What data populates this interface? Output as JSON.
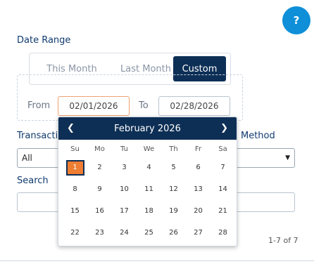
{
  "help": {
    "label": "?"
  },
  "date_range": {
    "label": "Date Range",
    "options": [
      "This Month",
      "Last Month",
      "Custom"
    ],
    "selected": "Custom"
  },
  "range": {
    "from_label": "From",
    "from_value": "02/01/2026",
    "to_label": "To",
    "to_value": "02/28/2026"
  },
  "filters": {
    "transaction_label": "Transactio",
    "transaction_value": "All",
    "method_label": "Method",
    "search_label": "Search"
  },
  "calendar": {
    "title": "February 2026",
    "weekdays": [
      "Su",
      "Mo",
      "Tu",
      "We",
      "Th",
      "Fr",
      "Sa"
    ],
    "weeks": [
      [
        "1",
        "2",
        "3",
        "4",
        "5",
        "6",
        "7"
      ],
      [
        "8",
        "9",
        "10",
        "11",
        "12",
        "13",
        "14"
      ],
      [
        "15",
        "16",
        "17",
        "18",
        "19",
        "20",
        "21"
      ],
      [
        "22",
        "23",
        "24",
        "25",
        "26",
        "27",
        "28"
      ]
    ],
    "selected_day": "1"
  },
  "results": {
    "count": "1-7 of 7"
  },
  "colors": {
    "navy": "#0d2f56",
    "accent": "#ef7d32",
    "help": "#0e8fd8"
  }
}
